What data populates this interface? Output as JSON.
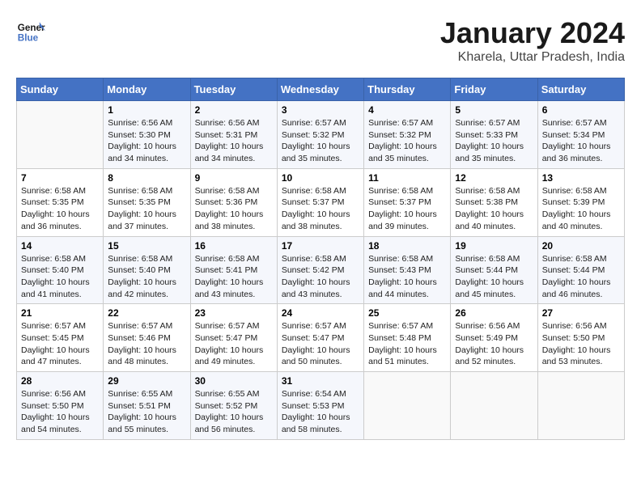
{
  "logo": {
    "name_general": "General",
    "name_blue": "Blue"
  },
  "title": "January 2024",
  "subtitle": "Kharela, Uttar Pradesh, India",
  "days_header": [
    "Sunday",
    "Monday",
    "Tuesday",
    "Wednesday",
    "Thursday",
    "Friday",
    "Saturday"
  ],
  "weeks": [
    [
      {
        "num": "",
        "info": ""
      },
      {
        "num": "1",
        "info": "Sunrise: 6:56 AM\nSunset: 5:30 PM\nDaylight: 10 hours\nand 34 minutes."
      },
      {
        "num": "2",
        "info": "Sunrise: 6:56 AM\nSunset: 5:31 PM\nDaylight: 10 hours\nand 34 minutes."
      },
      {
        "num": "3",
        "info": "Sunrise: 6:57 AM\nSunset: 5:32 PM\nDaylight: 10 hours\nand 35 minutes."
      },
      {
        "num": "4",
        "info": "Sunrise: 6:57 AM\nSunset: 5:32 PM\nDaylight: 10 hours\nand 35 minutes."
      },
      {
        "num": "5",
        "info": "Sunrise: 6:57 AM\nSunset: 5:33 PM\nDaylight: 10 hours\nand 35 minutes."
      },
      {
        "num": "6",
        "info": "Sunrise: 6:57 AM\nSunset: 5:34 PM\nDaylight: 10 hours\nand 36 minutes."
      }
    ],
    [
      {
        "num": "7",
        "info": "Sunrise: 6:58 AM\nSunset: 5:35 PM\nDaylight: 10 hours\nand 36 minutes."
      },
      {
        "num": "8",
        "info": "Sunrise: 6:58 AM\nSunset: 5:35 PM\nDaylight: 10 hours\nand 37 minutes."
      },
      {
        "num": "9",
        "info": "Sunrise: 6:58 AM\nSunset: 5:36 PM\nDaylight: 10 hours\nand 38 minutes."
      },
      {
        "num": "10",
        "info": "Sunrise: 6:58 AM\nSunset: 5:37 PM\nDaylight: 10 hours\nand 38 minutes."
      },
      {
        "num": "11",
        "info": "Sunrise: 6:58 AM\nSunset: 5:37 PM\nDaylight: 10 hours\nand 39 minutes."
      },
      {
        "num": "12",
        "info": "Sunrise: 6:58 AM\nSunset: 5:38 PM\nDaylight: 10 hours\nand 40 minutes."
      },
      {
        "num": "13",
        "info": "Sunrise: 6:58 AM\nSunset: 5:39 PM\nDaylight: 10 hours\nand 40 minutes."
      }
    ],
    [
      {
        "num": "14",
        "info": "Sunrise: 6:58 AM\nSunset: 5:40 PM\nDaylight: 10 hours\nand 41 minutes."
      },
      {
        "num": "15",
        "info": "Sunrise: 6:58 AM\nSunset: 5:40 PM\nDaylight: 10 hours\nand 42 minutes."
      },
      {
        "num": "16",
        "info": "Sunrise: 6:58 AM\nSunset: 5:41 PM\nDaylight: 10 hours\nand 43 minutes."
      },
      {
        "num": "17",
        "info": "Sunrise: 6:58 AM\nSunset: 5:42 PM\nDaylight: 10 hours\nand 43 minutes."
      },
      {
        "num": "18",
        "info": "Sunrise: 6:58 AM\nSunset: 5:43 PM\nDaylight: 10 hours\nand 44 minutes."
      },
      {
        "num": "19",
        "info": "Sunrise: 6:58 AM\nSunset: 5:44 PM\nDaylight: 10 hours\nand 45 minutes."
      },
      {
        "num": "20",
        "info": "Sunrise: 6:58 AM\nSunset: 5:44 PM\nDaylight: 10 hours\nand 46 minutes."
      }
    ],
    [
      {
        "num": "21",
        "info": "Sunrise: 6:57 AM\nSunset: 5:45 PM\nDaylight: 10 hours\nand 47 minutes."
      },
      {
        "num": "22",
        "info": "Sunrise: 6:57 AM\nSunset: 5:46 PM\nDaylight: 10 hours\nand 48 minutes."
      },
      {
        "num": "23",
        "info": "Sunrise: 6:57 AM\nSunset: 5:47 PM\nDaylight: 10 hours\nand 49 minutes."
      },
      {
        "num": "24",
        "info": "Sunrise: 6:57 AM\nSunset: 5:47 PM\nDaylight: 10 hours\nand 50 minutes."
      },
      {
        "num": "25",
        "info": "Sunrise: 6:57 AM\nSunset: 5:48 PM\nDaylight: 10 hours\nand 51 minutes."
      },
      {
        "num": "26",
        "info": "Sunrise: 6:56 AM\nSunset: 5:49 PM\nDaylight: 10 hours\nand 52 minutes."
      },
      {
        "num": "27",
        "info": "Sunrise: 6:56 AM\nSunset: 5:50 PM\nDaylight: 10 hours\nand 53 minutes."
      }
    ],
    [
      {
        "num": "28",
        "info": "Sunrise: 6:56 AM\nSunset: 5:50 PM\nDaylight: 10 hours\nand 54 minutes."
      },
      {
        "num": "29",
        "info": "Sunrise: 6:55 AM\nSunset: 5:51 PM\nDaylight: 10 hours\nand 55 minutes."
      },
      {
        "num": "30",
        "info": "Sunrise: 6:55 AM\nSunset: 5:52 PM\nDaylight: 10 hours\nand 56 minutes."
      },
      {
        "num": "31",
        "info": "Sunrise: 6:54 AM\nSunset: 5:53 PM\nDaylight: 10 hours\nand 58 minutes."
      },
      {
        "num": "",
        "info": ""
      },
      {
        "num": "",
        "info": ""
      },
      {
        "num": "",
        "info": ""
      }
    ]
  ]
}
